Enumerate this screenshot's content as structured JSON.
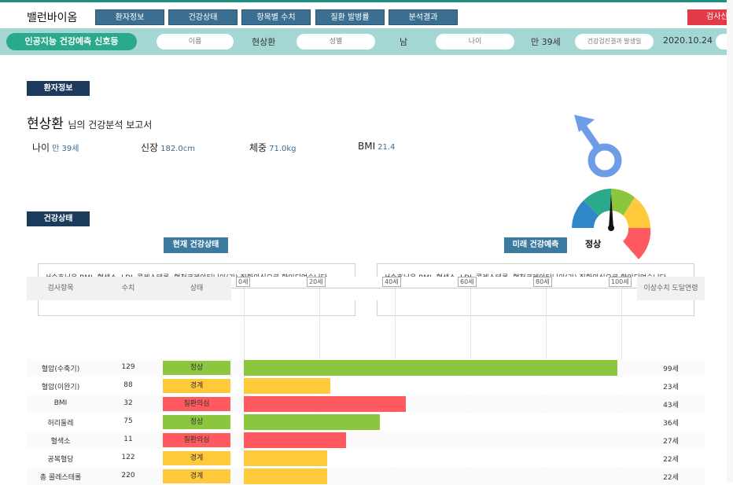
{
  "app": {
    "brand": "밸런바이옴",
    "nav": [
      "환자정보",
      "건강상태",
      "항목별 수치",
      "질환 발병률",
      "분석결과"
    ],
    "action_button": "검사신청"
  },
  "infobar": {
    "title": "인공지능 건강예측 신호등",
    "fields": [
      {
        "label": "이름",
        "value": "현상환"
      },
      {
        "label": "성별",
        "value": "남"
      },
      {
        "label": "나이",
        "value": "만 39세"
      },
      {
        "label": "건강검진결과 발생일",
        "value": "2020.10.24"
      }
    ]
  },
  "patient": {
    "section_label": "환자정보",
    "name": "현상환",
    "report_suffix": "님의 건강분석 보고서",
    "metrics": [
      {
        "label": "나이",
        "value": "만 39세"
      },
      {
        "label": "신장",
        "value": "182.0cm"
      },
      {
        "label": "체중",
        "value": "71.0kg"
      },
      {
        "label": "BMI",
        "value": "21.4"
      }
    ],
    "gender_icon": "male-symbol-icon",
    "gauge_label": "정상"
  },
  "health": {
    "section_label": "건강상태",
    "current_label": "현재 건강상태",
    "future_label": "미래 건강예측",
    "current_comment": "서승호님은 BMI, 혈색소, LDL 콜레스테롤, 혈청크레아티닌이(가) 질환의심으로 확인되었습니다.",
    "future_comment": "서승호님은 BMI, 혈색소, LDL 콜레스테롤, 혈청크레아티닌이(가) 질환의심으로 확인되었습니다."
  },
  "table": {
    "headers": [
      "검사항목",
      "수치",
      "상태",
      "이상수치 도달연령"
    ],
    "axis_ticks": [
      "0세",
      "20세",
      "40세",
      "60세",
      "80세",
      "100세"
    ],
    "axis_max": 100,
    "status_colors": {
      "정상": "#8cc63f",
      "경계": "#ffc93c",
      "질환의심": "#ff5a5f"
    },
    "rows": [
      {
        "item": "혈압(수축기)",
        "value": "129",
        "status": "정상",
        "bar_age": 99,
        "age": "99세"
      },
      {
        "item": "혈압(이완기)",
        "value": "88",
        "status": "경계",
        "bar_age": 23,
        "age": "23세"
      },
      {
        "item": "BMI",
        "value": "32",
        "status": "질환의심",
        "bar_age": 43,
        "age": "43세"
      },
      {
        "item": "허리둘레",
        "value": "75",
        "status": "정상",
        "bar_age": 36,
        "age": "36세"
      },
      {
        "item": "혈색소",
        "value": "11",
        "status": "질환의심",
        "bar_age": 27,
        "age": "27세"
      },
      {
        "item": "공복혈당",
        "value": "122",
        "status": "경계",
        "bar_age": 22,
        "age": "22세"
      },
      {
        "item": "총 콜레스테롤",
        "value": "220",
        "status": "경계",
        "bar_age": 22,
        "age": "22세"
      }
    ]
  }
}
